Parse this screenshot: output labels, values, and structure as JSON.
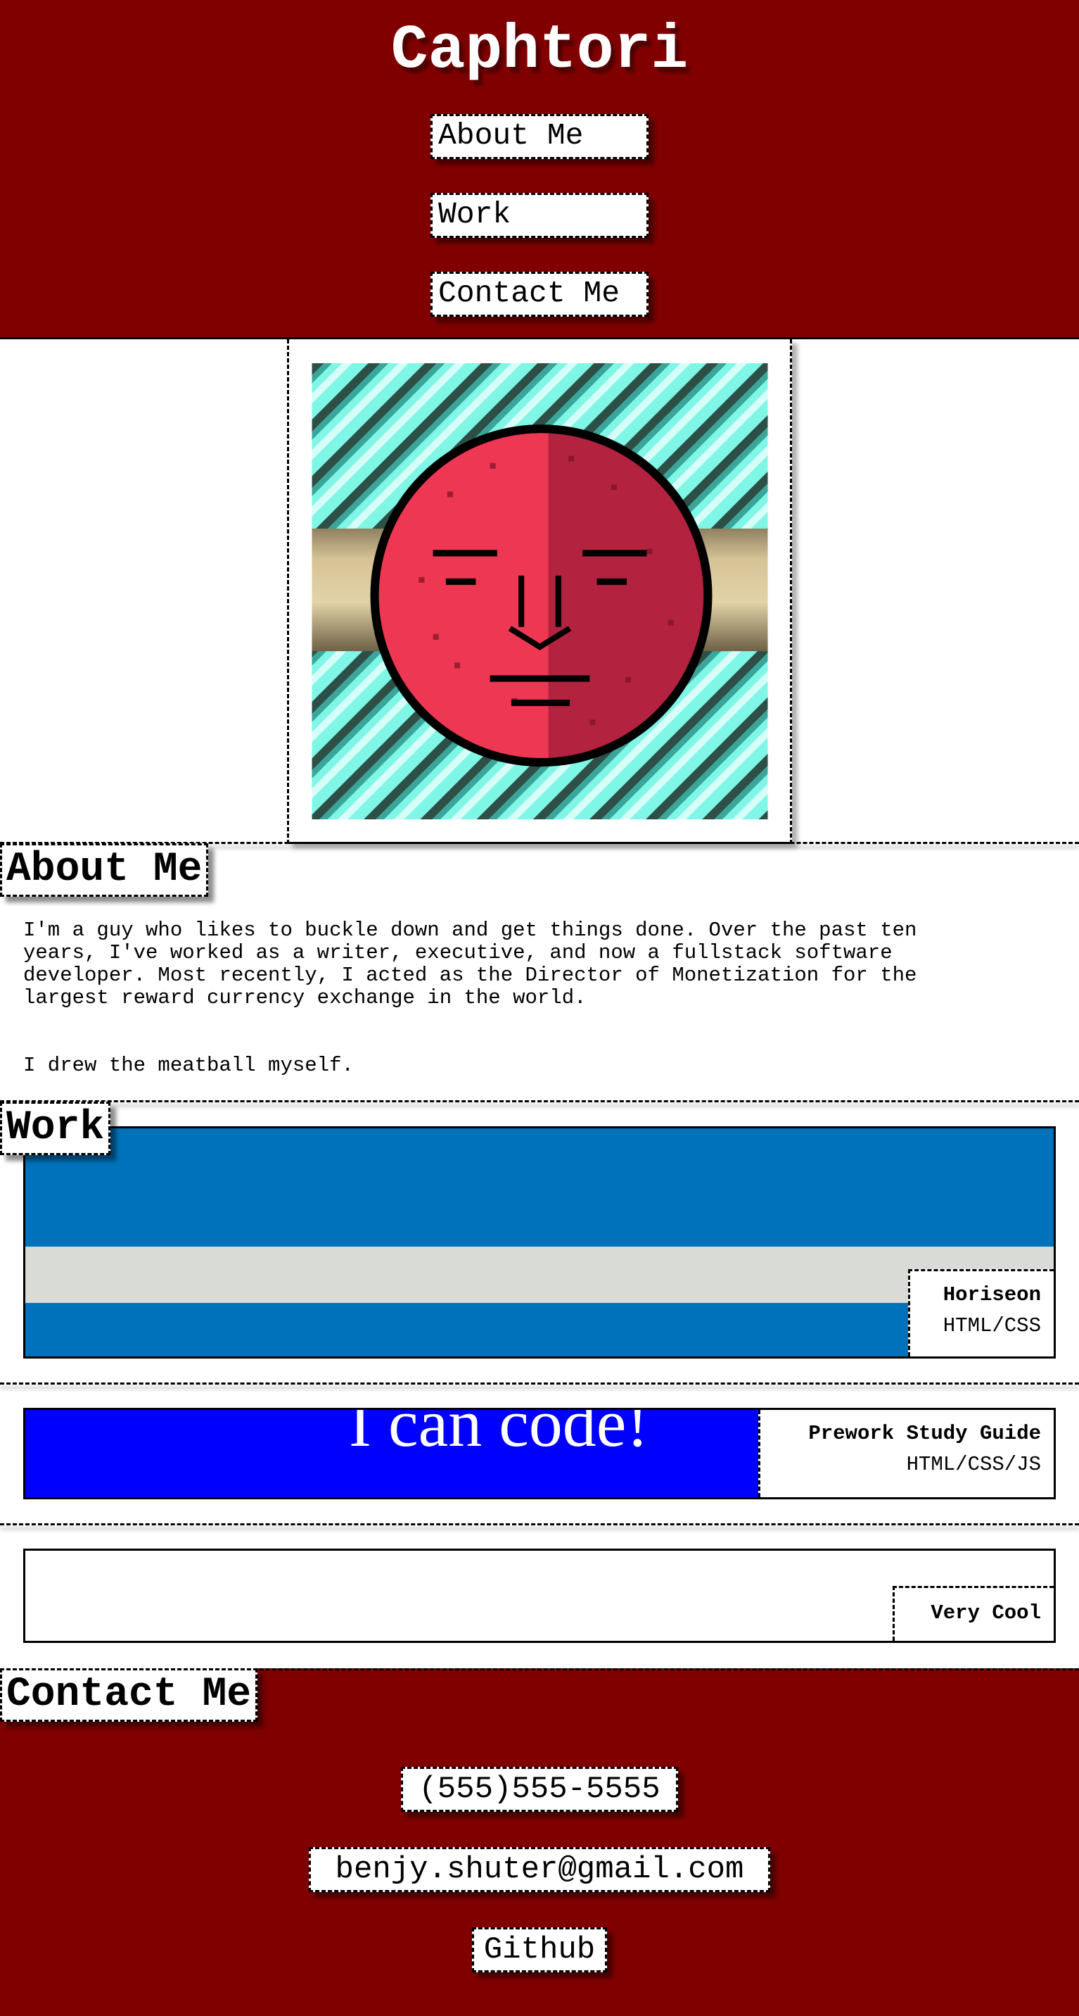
{
  "header": {
    "title": "Caphtori",
    "nav": [
      "About Me",
      "Work",
      "Contact Me"
    ]
  },
  "avatar": {
    "alt": "meatball self-portrait",
    "colors": {
      "background": "#7ff6e6",
      "stripe_dark": "#2d4f46",
      "stripe_light": "#d6fff8",
      "face_left": "#ee3752",
      "face_right": "#b3233f",
      "bar": "#d6c396"
    }
  },
  "about": {
    "heading": "About Me",
    "paragraph1": "I'm a guy who likes to buckle down and get things done. Over the past ten\nyears, I've worked as a writer, executive, and now a fullstack software\ndeveloper. Most recently, I acted as the Director of Monetization for the\nlargest reward currency exchange in the world.",
    "paragraph2": "I drew the meatball myself."
  },
  "work": {
    "heading": "Work",
    "projects": [
      {
        "title": "Horiseon",
        "tech": "HTML/CSS"
      },
      {
        "title": "Prework Study Guide",
        "tech": "HTML/CSS/JS",
        "preview_text": "I can code!"
      },
      {
        "title": "Very Cool",
        "tech": ""
      }
    ]
  },
  "contact": {
    "heading": "Contact Me",
    "phone": "(555)555-5555",
    "email": "benjy.shuter@gmail.com",
    "github": "Github"
  },
  "colors": {
    "brand": "#800000",
    "horiseon_blue": "#0072bb",
    "horiseon_gray": "#d9dbd6",
    "prework_blue": "#0000ff"
  }
}
